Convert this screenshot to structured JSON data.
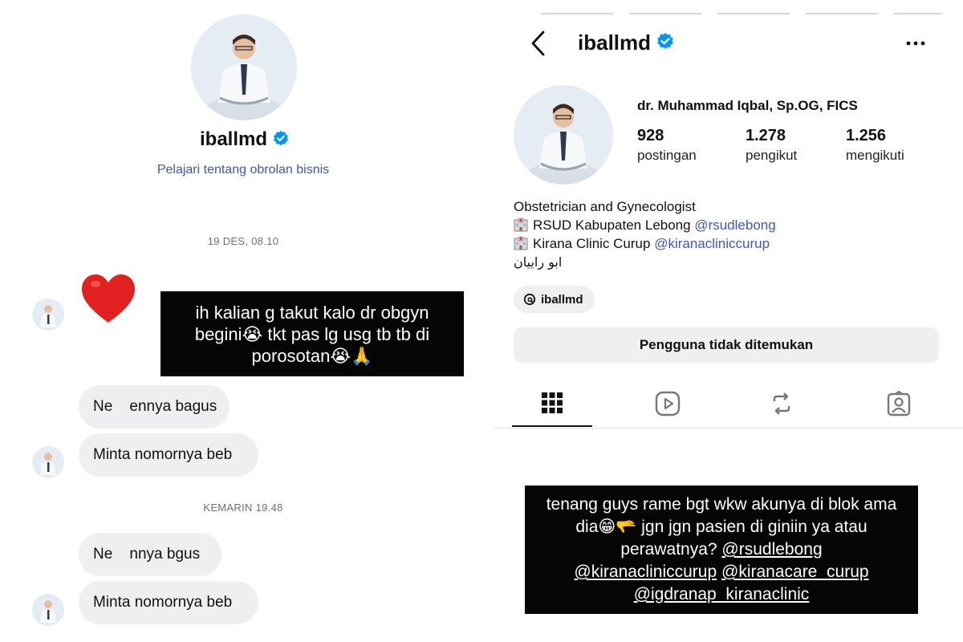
{
  "chat": {
    "username": "iballmd",
    "learn_link": "Pelajari tentang obrolan bisnis",
    "timestamp_1": "19 DES, 08.10",
    "timestamp_2": "KEMARIN 19.48",
    "reaction": "❤️",
    "story_caption": "ih kalian g takut kalo dr obgyn begini😭 tkt pas lg usg tb tb di porosotan😭🙏",
    "messages": [
      {
        "text": "Ne    ennya bagus"
      },
      {
        "text": "Minta nomornya beb"
      },
      {
        "text": "Ne    nnya bgus"
      },
      {
        "text": "Minta nomornya beb"
      }
    ]
  },
  "profile": {
    "username": "iballmd",
    "full_name": "dr. Muhammad Iqbal, Sp.OG, FICS",
    "stats": [
      {
        "value": "928",
        "label": "postingan"
      },
      {
        "value": "1.278",
        "label": "pengikut"
      },
      {
        "value": "1.256",
        "label": "mengikuti"
      }
    ],
    "bio": {
      "line1": "Obstetrician and Gynecologist",
      "line2_text": "RSUD Kabupaten Lebong ",
      "line2_mention": "@rsudlebong",
      "line3_text": "Kirana Clinic Curup ",
      "line3_mention": "@kiranacliniccurup",
      "line4": "ابو راييان"
    },
    "threads_handle": "iballmd",
    "notfound_button": "Pengguna tidak ditemukan",
    "tabs": [
      "grid-icon",
      "reels-icon",
      "repost-icon",
      "tagged-icon"
    ],
    "caption": {
      "text": "tenang guys rame bgt wkw akunya di blok ama dia😁🫳 jgn jgn pasien di giniin ya atau perawatnya? ",
      "mention1": "@rsudlebong",
      "mention2": "@kiranacliniccurup",
      "mention3": "@kiranacare_curup",
      "mention4": "@igdranap_kiranaclinic"
    }
  },
  "colors": {
    "link_blue": "#3e55c9",
    "verified_blue": "#0095f6",
    "bubble_gray": "#efeff1",
    "caption_black": "#050505",
    "heart_red": "#e0211f"
  }
}
